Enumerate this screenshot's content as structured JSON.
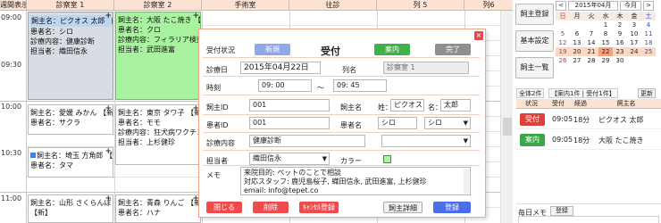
{
  "schedule": {
    "header": {
      "time_col": "週間表示",
      "rooms": [
        "診察室 1",
        "診察室 2",
        "手術室",
        "往診",
        "列 5",
        "列6"
      ]
    },
    "times": [
      "09:00",
      "09:30",
      "10:00",
      "10:30",
      "11:00"
    ],
    "appointments": [
      {
        "owner": "飼主名：ピクオス 太郎 【受】",
        "pet": "患者名：シロ",
        "detail": "診療内容：健康診断",
        "staff": "担当者：織田信永"
      },
      {
        "owner": "飼主名：大阪 たこ焼き 【案】",
        "pet": "患者名：クロ",
        "detail": "診療内容：フィラリア検査",
        "staff": "担当者：武田進富"
      },
      {
        "owner": "飼主名：愛媛 みかん 【新】",
        "pet": "患者名：サクラ",
        "detail": "",
        "staff": ""
      },
      {
        "owner": "飼主名：東京 タワ子 【新】",
        "pet": "患者名：モモ",
        "detail": "診療内容：狂犬病ワクチン",
        "staff": "担当者：上杉健珍"
      },
      {
        "owner": "飼主名：埼玉 方角郎 【新】",
        "pet": "患者名：タマ",
        "detail": "",
        "staff": ""
      },
      {
        "owner": "飼主名：山形 さくらんぼ",
        "pet": "【新】",
        "detail": "",
        "staff": ""
      },
      {
        "owner": "飼主名：青森 りんご 【新】",
        "pet": "患者名：ハナ",
        "detail": "",
        "staff": ""
      }
    ]
  },
  "modal": {
    "status_label": "受付状況",
    "status_buttons": {
      "new": "新規",
      "guide": "案内",
      "done": "完了"
    },
    "status_current": "受付",
    "date_label": "診療日",
    "date_value": "2015年04月22日",
    "column_label": "列名",
    "column_value": "診察室 1",
    "time_label": "時刻",
    "time_start": "09: 00",
    "time_sep": "～",
    "time_end": "09: 45",
    "owner_id_label": "飼主ID",
    "owner_id_value": "001",
    "owner_name_label": "飼主名",
    "last_name_label": "姓：",
    "last_name_value": "ピクオス",
    "first_name_label": "名：",
    "first_name_value": "太郎",
    "patient_id_label": "患者ID",
    "patient_id_value": "001",
    "patient_name_label": "患者名",
    "patient_name_value": "シロ",
    "patient_select_value": "シロ",
    "content_label": "診療内容",
    "content_value": "健康診断",
    "content_select_value": "",
    "staff_label": "担当者",
    "staff_value": "織田信永",
    "color_label": "カラー",
    "memo_label": "メモ",
    "memo_lines": [
      "来院目的: ペットのことで相談",
      "対応スタッフ: 鹿児島桜子, 織田信永, 武田進富, 上杉健珍",
      "email: info@tepet.co"
    ],
    "footer_buttons": {
      "close": "閉じる",
      "delete": "削除",
      "cancel_reg": "ｷｬﾝｾﾙ登録",
      "owner_detail": "飼主詳細",
      "register": "登録"
    },
    "close_x": "×"
  },
  "side": {
    "buttons": [
      "飼主登録",
      "基本設定",
      "飼主一覧"
    ],
    "calendar": {
      "prev": "<",
      "month": "2015年04月",
      "today": "今月",
      "next": ">",
      "weekdays": [
        "日",
        "月",
        "火",
        "水",
        "木",
        "金",
        "土"
      ],
      "weeks": [
        [
          "",
          "",
          "",
          "1",
          "2",
          "3",
          "4"
        ],
        [
          "5",
          "6",
          "7",
          "8",
          "9",
          "10",
          "11"
        ],
        [
          "12",
          "13",
          "14",
          "15",
          "16",
          "17",
          "18"
        ],
        [
          "19",
          "20",
          "21",
          "22",
          "23",
          "24",
          "25"
        ],
        [
          "26",
          "27",
          "28",
          "29",
          "30",
          "",
          ""
        ],
        [
          "",
          "",
          "",
          "",
          "",
          "",
          ""
        ]
      ],
      "selected_day": "22"
    },
    "summary": {
      "all": "全体2件",
      "guide": "【案内1件 | 受付1件】",
      "refresh": "更新"
    },
    "list_headers": [
      "状況",
      "受付",
      "経過",
      "飼主名"
    ],
    "list_rows": [
      {
        "status": "受付",
        "time": "09:05",
        "elapsed": "18分",
        "owner": "ピクオス 太郎",
        "color": "#e0403a"
      },
      {
        "status": "案内",
        "time": "09:05",
        "elapsed": "18分",
        "owner": "大阪 たこ焼き",
        "color": "#3aa84a"
      }
    ],
    "daily_memo": {
      "label": "毎日メモ",
      "button": "登録"
    }
  }
}
